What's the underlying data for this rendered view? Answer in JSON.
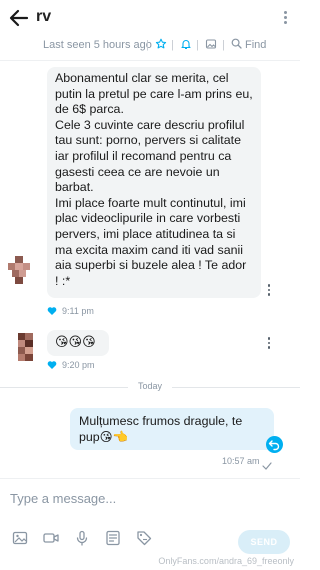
{
  "header": {
    "chat_name": "rv",
    "last_seen": "Last seen 5 hours ago",
    "find_label": "Find"
  },
  "messages": [
    {
      "direction": "incoming",
      "paragraphs": [
        "Abonamentul clar se merita, cel putin la pretul pe care l-am prins eu, de 6$ parca.",
        "Cele 3 cuvinte care descriu profilul tau sunt: porno, pervers si calitate iar profilul il recomand pentru ca gasesti ceea ce are nevoie un barbat.",
        "Imi place foarte mult continutul, imi plac videoclipurile in care vorbesti pervers, imi place atitudinea ta si ma excita maxim cand iti vad sanii aia superbi si buzele alea ! Te ador ! :*"
      ],
      "time": "9:11 pm"
    },
    {
      "direction": "incoming",
      "text": "😘😘😘",
      "time": "9:20 pm"
    },
    {
      "direction": "outgoing",
      "text": "Mulțumesc frumos dragule, te pup😘👈",
      "time": "10:57 am"
    }
  ],
  "day_separator": "Today",
  "composer": {
    "placeholder": "Type a message...",
    "send_label": "SEND"
  },
  "watermark": "OnlyFans.com/andra_69_freeonly",
  "colors": {
    "accent": "#00aff0",
    "incoming_bubble": "#f2f4f5",
    "outgoing_bubble": "#e2f2fb",
    "muted_text": "#8a96a3"
  },
  "icons": {
    "header": [
      "back-arrow-icon",
      "more-vertical-icon"
    ],
    "subbar": [
      "star-icon",
      "bell-icon",
      "image-icon",
      "search-icon"
    ],
    "toolbar": [
      "image-icon",
      "video-icon",
      "microphone-icon",
      "checklist-icon",
      "price-tag-icon"
    ]
  }
}
